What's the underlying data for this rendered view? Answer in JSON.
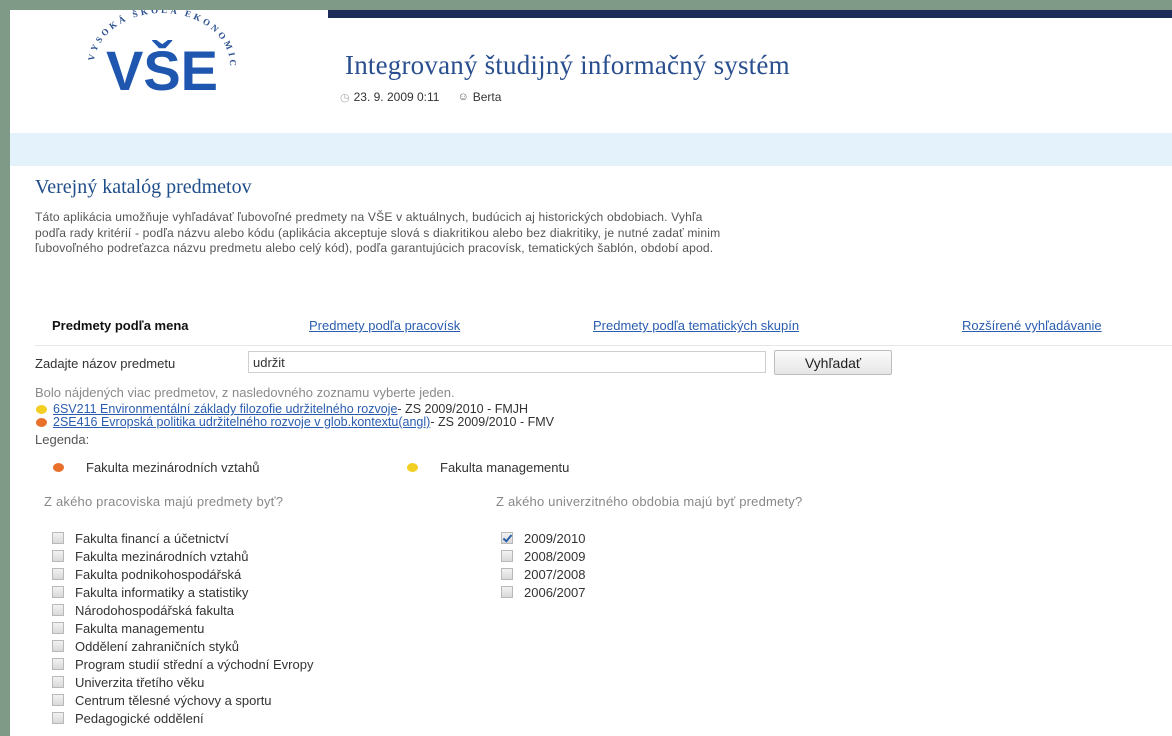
{
  "header": {
    "logo_text": "VŠE",
    "logo_ring_text": "VYSOKÁ ŠKOLA EKONOMICKÁ V PRAZE",
    "system_title": "Integrovaný študijný informačný systém",
    "date": "23. 9. 2009 0:11",
    "user": "Berta"
  },
  "main": {
    "title": "Verejný katalóg predmetov",
    "intro_lines": [
      "Táto aplikácia umožňuje vyhľadávať ľubovoľné predmety na VŠE v aktuálnych, budúcich aj historických obdobiach. Vyhľa",
      "podľa rady kritérií - podľa názvu alebo kódu (aplikácia akceptuje slová s diakritikou alebo bez diakritiky, je nutné zadať minim",
      "ľubovoľného podreťazca názvu predmetu alebo celý kód), podľa garantujúcich pracovísk, tematických šablón, období apod."
    ]
  },
  "tabs": [
    {
      "label": "Predmety podľa mena",
      "active": true
    },
    {
      "label": "Predmety podľa pracovísk",
      "active": false
    },
    {
      "label": "Predmety podľa tematických skupín",
      "active": false
    },
    {
      "label": "Rozšírené vyhľadávanie",
      "active": false
    }
  ],
  "search": {
    "label": "Zadajte názov predmetu",
    "value": "udržit",
    "button_label": "Vyhľadať"
  },
  "results": {
    "message": "Bolo nájdených viac predmetov, z nasledovného zoznamu vyberte jeden.",
    "items": [
      {
        "dot_color": "#f2cf22",
        "link": "6SV211 Environmentální základy filozofie udržitelného rozvoje",
        "suffix": " - ZS 2009/2010 - FMJH"
      },
      {
        "dot_color": "#e8702a",
        "link": "2SE416 Evropská politika udržitelného rozvoje v glob.kontextu(angl)",
        "suffix": " - ZS 2009/2010 - FMV"
      }
    ]
  },
  "legend": {
    "label": "Legenda:",
    "items": [
      {
        "dot_color": "#e8702a",
        "label": "Fakulta mezinárodních vztahů"
      },
      {
        "dot_color": "#f2cf22",
        "label": "Fakulta managementu"
      }
    ]
  },
  "filters": {
    "workplace_question": "Z akého pracoviska majú predmety byť?",
    "period_question": "Z akého univerzitného obdobia majú byť predmety?",
    "workplaces": [
      {
        "label": "Fakulta financí a účetnictví",
        "checked": false
      },
      {
        "label": "Fakulta mezinárodních vztahů",
        "checked": false
      },
      {
        "label": "Fakulta podnikohospodářská",
        "checked": false
      },
      {
        "label": "Fakulta informatiky a statistiky",
        "checked": false
      },
      {
        "label": "Národohospodářská fakulta",
        "checked": false
      },
      {
        "label": "Fakulta managementu",
        "checked": false
      },
      {
        "label": "Oddělení zahraničních styků",
        "checked": false
      },
      {
        "label": "Program studií střední a východní Evropy",
        "checked": false
      },
      {
        "label": "Univerzita třetího věku",
        "checked": false
      },
      {
        "label": "Centrum tělesné výchovy a sportu",
        "checked": false
      },
      {
        "label": "Pedagogické oddělení",
        "checked": false
      }
    ],
    "periods": [
      {
        "label": "2009/2010",
        "checked": true
      },
      {
        "label": "2008/2009",
        "checked": false
      },
      {
        "label": "2007/2008",
        "checked": false
      },
      {
        "label": "2006/2007",
        "checked": false
      }
    ]
  },
  "colors": {
    "frame": "#7f9a86",
    "top_bar": "#1e2c5a",
    "title_blue": "#2a4f8e",
    "link_blue": "#2a5db0",
    "info_bar": "#e4f3fb"
  },
  "icons": {
    "clock": "clock-icon",
    "user": "user-icon"
  }
}
